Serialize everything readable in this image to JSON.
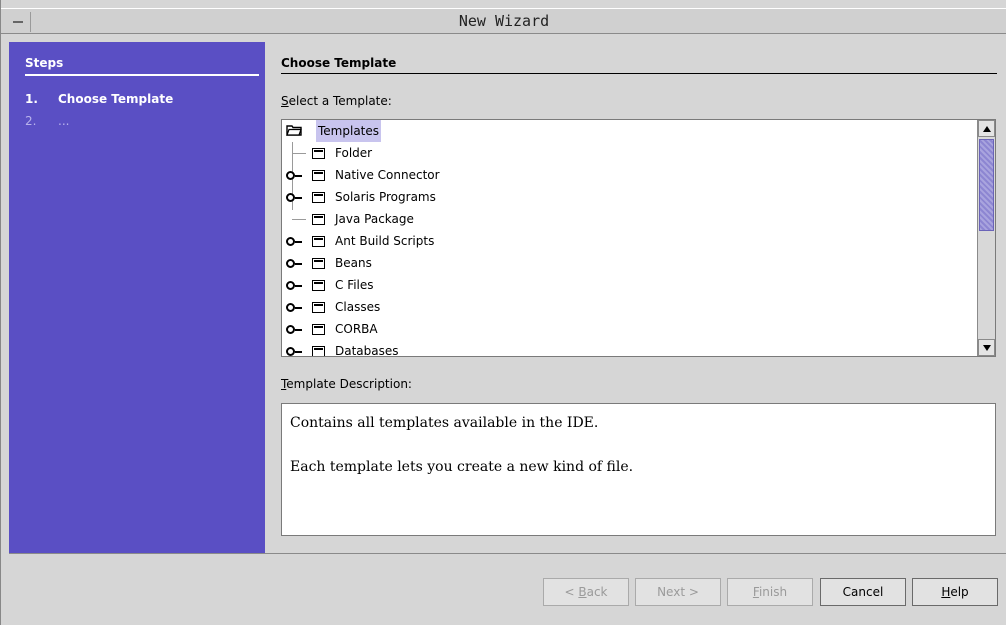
{
  "window": {
    "title": "New Wizard"
  },
  "steps": {
    "header": "Steps",
    "items": [
      {
        "num": "1.",
        "label": "Choose Template"
      },
      {
        "num": "2.",
        "label": "..."
      }
    ]
  },
  "main": {
    "title": "Choose Template",
    "select_label_pre": "",
    "select_label_mnemonic": "S",
    "select_label_post": "elect a Template:",
    "tree": {
      "root": "Templates",
      "items": [
        "Folder",
        "Native Connector",
        "Solaris Programs",
        "Java Package",
        "Ant Build Scripts",
        "Beans",
        "C Files",
        "Classes",
        "CORBA",
        "Databases"
      ]
    },
    "desc_label_mnemonic": "T",
    "desc_label_post": "emplate Description:",
    "description": {
      "line1": "Contains all templates available in the IDE.",
      "line2": "Each template lets you create a new kind of file."
    }
  },
  "buttons": {
    "back_pre": "< ",
    "back_mn": "B",
    "back_post": "ack",
    "next": "Next >",
    "finish_mn": "F",
    "finish_post": "inish",
    "cancel": "Cancel",
    "help_mn": "H",
    "help_post": "elp"
  },
  "colors": {
    "steps_panel": "#5a4fc4",
    "selection": "#c8c4ee"
  }
}
